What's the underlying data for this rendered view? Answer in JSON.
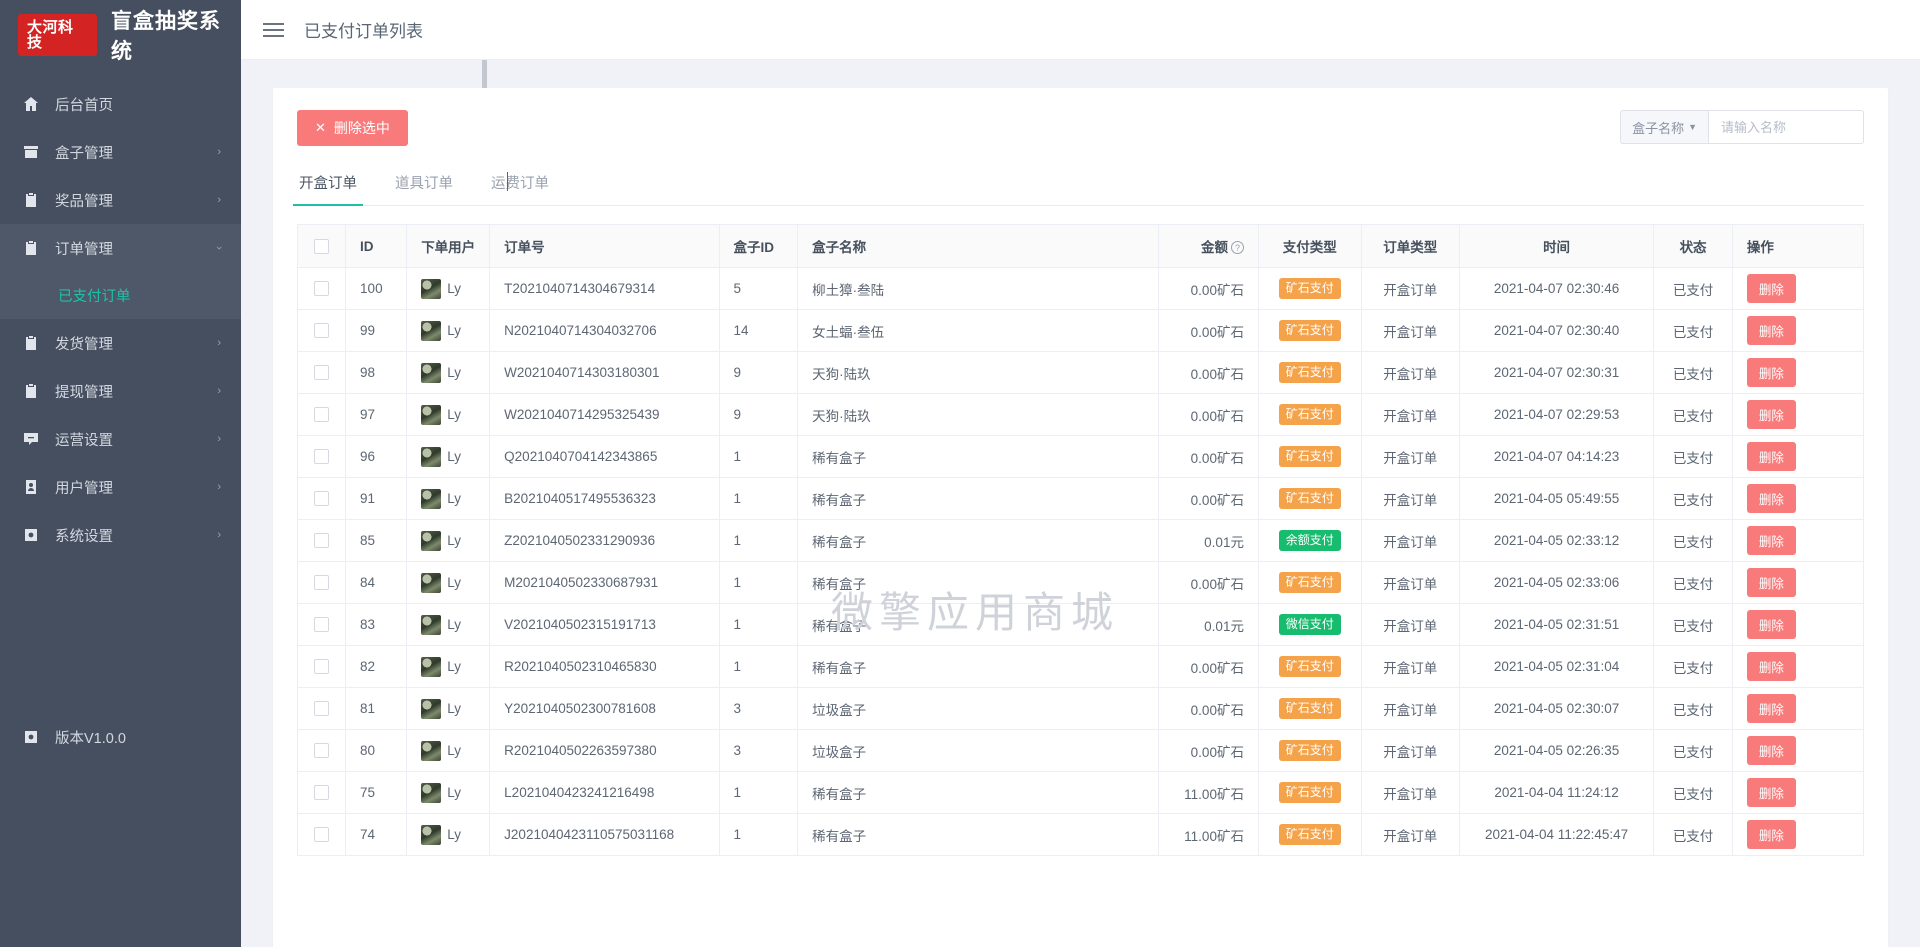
{
  "brand": {
    "badge": "大河科技",
    "title": "盲盒抽奖系统"
  },
  "topbar": {
    "menu_icon": "hamburger-icon",
    "title": "已支付订单列表"
  },
  "sidebar": {
    "items": [
      {
        "label": "后台首页",
        "icon": "home-icon",
        "arrow": "",
        "active": false
      },
      {
        "label": "盒子管理",
        "icon": "box-icon",
        "arrow": "›",
        "active": false
      },
      {
        "label": "奖品管理",
        "icon": "clipboard-icon",
        "arrow": "›",
        "active": false
      },
      {
        "label": "订单管理",
        "icon": "order-icon",
        "arrow": "⌄",
        "active": true
      },
      {
        "label": "发货管理",
        "icon": "ship-icon",
        "arrow": "›",
        "active": false
      },
      {
        "label": "提现管理",
        "icon": "withdraw-icon",
        "arrow": "›",
        "active": false
      },
      {
        "label": "运营设置",
        "icon": "ops-icon",
        "arrow": "›",
        "active": false
      },
      {
        "label": "用户管理",
        "icon": "user-icon",
        "arrow": "›",
        "active": false
      },
      {
        "label": "系统设置",
        "icon": "gear-icon",
        "arrow": "›",
        "active": false
      }
    ],
    "submenu": [
      {
        "label": "已支付订单",
        "active": true
      }
    ],
    "version": {
      "label": "版本V1.0.0",
      "icon": "gear-icon"
    }
  },
  "toolbar": {
    "delete_selected_label": "删除选中",
    "delete_selected_icon": "close-icon",
    "search_select_label": "盒子名称",
    "search_placeholder": "请输入名称",
    "search_value": ""
  },
  "tabs": [
    {
      "label": "开盒订单",
      "active": true
    },
    {
      "label": "道具订单",
      "active": false
    },
    {
      "label": "运费订单",
      "active": false
    }
  ],
  "table": {
    "columns": [
      "",
      "ID",
      "下单用户",
      "订单号",
      "盒子ID",
      "盒子名称",
      "金额",
      "支付类型",
      "订单类型",
      "时间",
      "状态",
      "操作"
    ],
    "amount_help_icon": "question-circle-icon",
    "delete_label": "删除",
    "rows": [
      {
        "id": "100",
        "user": "Ly",
        "order_no": "T2021040714304679314",
        "box_id": "5",
        "box_name": "柳土獐·叁陆",
        "amount": "0.00矿石",
        "pay_type": "矿石支付",
        "pay_style": "ore",
        "order_type": "开盒订单",
        "time": "2021-04-07 02:30:46",
        "status": "已支付"
      },
      {
        "id": "99",
        "user": "Ly",
        "order_no": "N2021040714304032706",
        "box_id": "14",
        "box_name": "女土蝠·叁伍",
        "amount": "0.00矿石",
        "pay_type": "矿石支付",
        "pay_style": "ore",
        "order_type": "开盒订单",
        "time": "2021-04-07 02:30:40",
        "status": "已支付"
      },
      {
        "id": "98",
        "user": "Ly",
        "order_no": "W2021040714303180301",
        "box_id": "9",
        "box_name": "天狗·陆玖",
        "amount": "0.00矿石",
        "pay_type": "矿石支付",
        "pay_style": "ore",
        "order_type": "开盒订单",
        "time": "2021-04-07 02:30:31",
        "status": "已支付"
      },
      {
        "id": "97",
        "user": "Ly",
        "order_no": "W2021040714295325439",
        "box_id": "9",
        "box_name": "天狗·陆玖",
        "amount": "0.00矿石",
        "pay_type": "矿石支付",
        "pay_style": "ore",
        "order_type": "开盒订单",
        "time": "2021-04-07 02:29:53",
        "status": "已支付"
      },
      {
        "id": "96",
        "user": "Ly",
        "order_no": "Q2021040704142343865",
        "box_id": "1",
        "box_name": "稀有盒子",
        "amount": "0.00矿石",
        "pay_type": "矿石支付",
        "pay_style": "ore",
        "order_type": "开盒订单",
        "time": "2021-04-07 04:14:23",
        "status": "已支付"
      },
      {
        "id": "91",
        "user": "Ly",
        "order_no": "B2021040517495536323",
        "box_id": "1",
        "box_name": "稀有盒子",
        "amount": "0.00矿石",
        "pay_type": "矿石支付",
        "pay_style": "ore",
        "order_type": "开盒订单",
        "time": "2021-04-05 05:49:55",
        "status": "已支付"
      },
      {
        "id": "85",
        "user": "Ly",
        "order_no": "Z2021040502331290936",
        "box_id": "1",
        "box_name": "稀有盒子",
        "amount": "0.01元",
        "pay_type": "余额支付",
        "pay_style": "balance",
        "order_type": "开盒订单",
        "time": "2021-04-05 02:33:12",
        "status": "已支付"
      },
      {
        "id": "84",
        "user": "Ly",
        "order_no": "M2021040502330687931",
        "box_id": "1",
        "box_name": "稀有盒子",
        "amount": "0.00矿石",
        "pay_type": "矿石支付",
        "pay_style": "ore",
        "order_type": "开盒订单",
        "time": "2021-04-05 02:33:06",
        "status": "已支付"
      },
      {
        "id": "83",
        "user": "Ly",
        "order_no": "V2021040502315191713",
        "box_id": "1",
        "box_name": "稀有盒子",
        "amount": "0.01元",
        "pay_type": "微信支付",
        "pay_style": "wechat",
        "order_type": "开盒订单",
        "time": "2021-04-05 02:31:51",
        "status": "已支付"
      },
      {
        "id": "82",
        "user": "Ly",
        "order_no": "R2021040502310465830",
        "box_id": "1",
        "box_name": "稀有盒子",
        "amount": "0.00矿石",
        "pay_type": "矿石支付",
        "pay_style": "ore",
        "order_type": "开盒订单",
        "time": "2021-04-05 02:31:04",
        "status": "已支付"
      },
      {
        "id": "81",
        "user": "Ly",
        "order_no": "Y2021040502300781608",
        "box_id": "3",
        "box_name": "垃圾盒子",
        "amount": "0.00矿石",
        "pay_type": "矿石支付",
        "pay_style": "ore",
        "order_type": "开盒订单",
        "time": "2021-04-05 02:30:07",
        "status": "已支付"
      },
      {
        "id": "80",
        "user": "Ly",
        "order_no": "R2021040502263597380",
        "box_id": "3",
        "box_name": "垃圾盒子",
        "amount": "0.00矿石",
        "pay_type": "矿石支付",
        "pay_style": "ore",
        "order_type": "开盒订单",
        "time": "2021-04-05 02:26:35",
        "status": "已支付"
      },
      {
        "id": "75",
        "user": "Ly",
        "order_no": "L2021040423241216498",
        "box_id": "1",
        "box_name": "稀有盒子",
        "amount": "11.00矿石",
        "pay_type": "矿石支付",
        "pay_style": "ore",
        "order_type": "开盒订单",
        "time": "2021-04-04 11:24:12",
        "status": "已支付"
      },
      {
        "id": "74",
        "user": "Ly",
        "order_no": "J2021040423110575031168",
        "box_id": "1",
        "box_name": "稀有盒子",
        "amount": "11.00矿石",
        "pay_type": "矿石支付",
        "pay_style": "ore",
        "order_type": "开盒订单",
        "time": "2021-04-04 11:22:45:47",
        "status": "已支付"
      }
    ]
  },
  "watermark": "微擎应用商城"
}
